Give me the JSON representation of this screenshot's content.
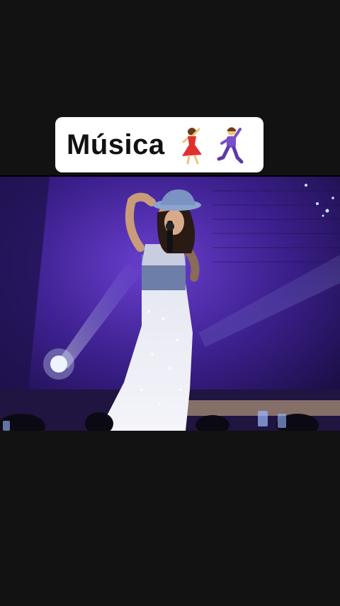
{
  "caption": {
    "text": "Música"
  },
  "emojis": [
    "woman-dancing-icon",
    "man-dancing-icon"
  ],
  "colors": {
    "background": "#121212",
    "card": "#ffffff",
    "stage": "#3b1f86"
  }
}
